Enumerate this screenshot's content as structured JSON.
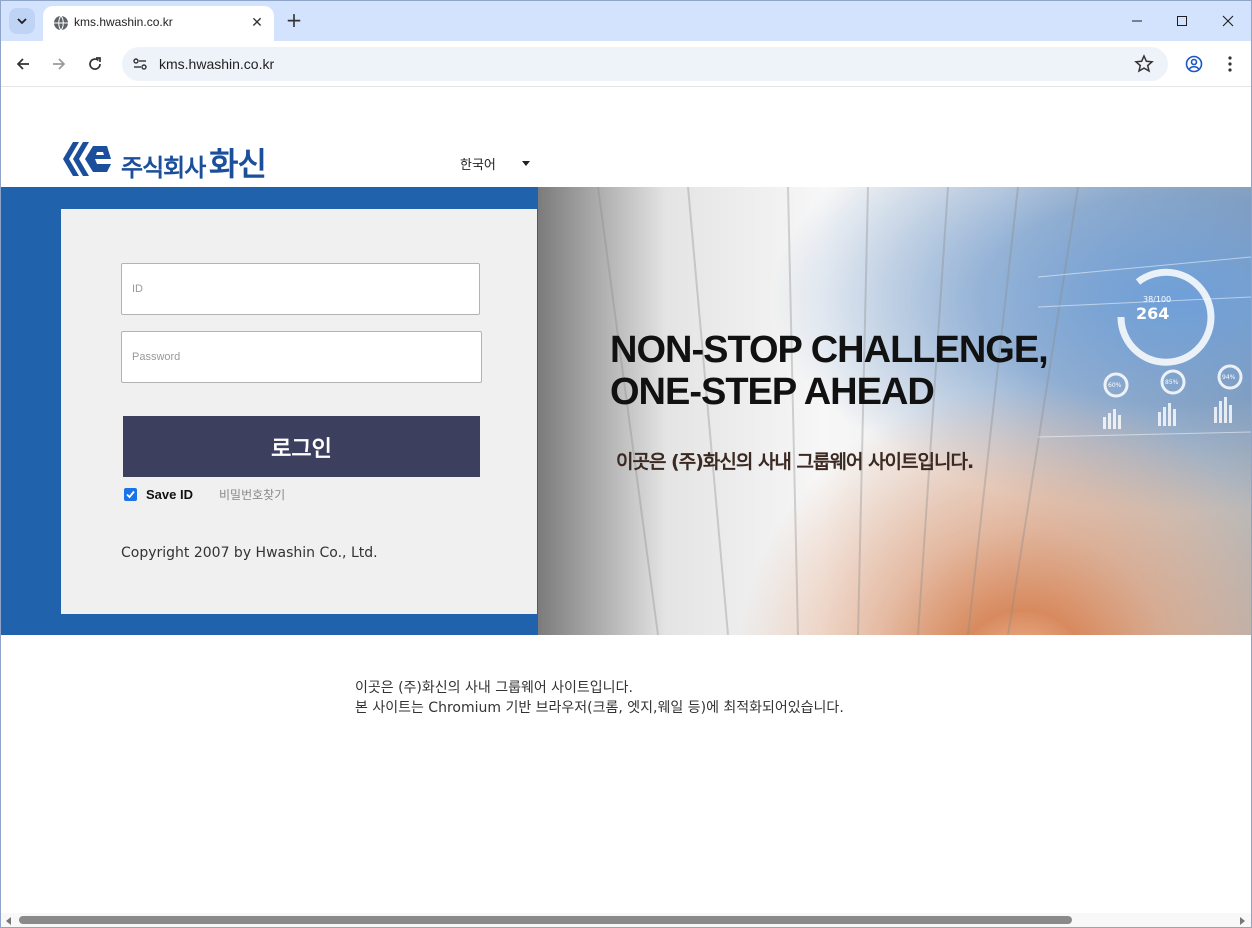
{
  "browser": {
    "tab_title": "kms.hwashin.co.kr",
    "url": "kms.hwashin.co.kr",
    "new_tab_symbol": "+",
    "close_symbol": "✕"
  },
  "header": {
    "logo_small": "주식회사",
    "logo_big": "화신",
    "language": "한국어"
  },
  "login": {
    "id_placeholder": "ID",
    "password_placeholder": "Password",
    "login_button": "로그인",
    "save_id_label": "Save ID",
    "save_id_checked": true,
    "find_password": "비밀번호찾기",
    "copyright": "Copyright 2007 by Hwashin Co., Ltd."
  },
  "hero": {
    "headline_line1": "NON-STOP CHALLENGE,",
    "headline_line2": "ONE-STEP AHEAD",
    "subtitle": "이곳은 (주)화신의 사내 그룹웨어 사이트입니다.",
    "gauge_value": "264",
    "gauge_label": "38/100",
    "small_gauges": [
      "60%",
      "85%",
      "94%"
    ]
  },
  "notice": {
    "line1": "이곳은 (주)화신의 사내 그룹웨어 사이트입니다.",
    "line2": "본 사이트는 Chromium 기반 브라우저(크롬, 엣지,웨일 등)에 최적화되어있습니다."
  },
  "colors": {
    "brand_blue": "#2062ac",
    "logo_blue": "#1b4f9c",
    "login_button": "#3d3f5e"
  }
}
